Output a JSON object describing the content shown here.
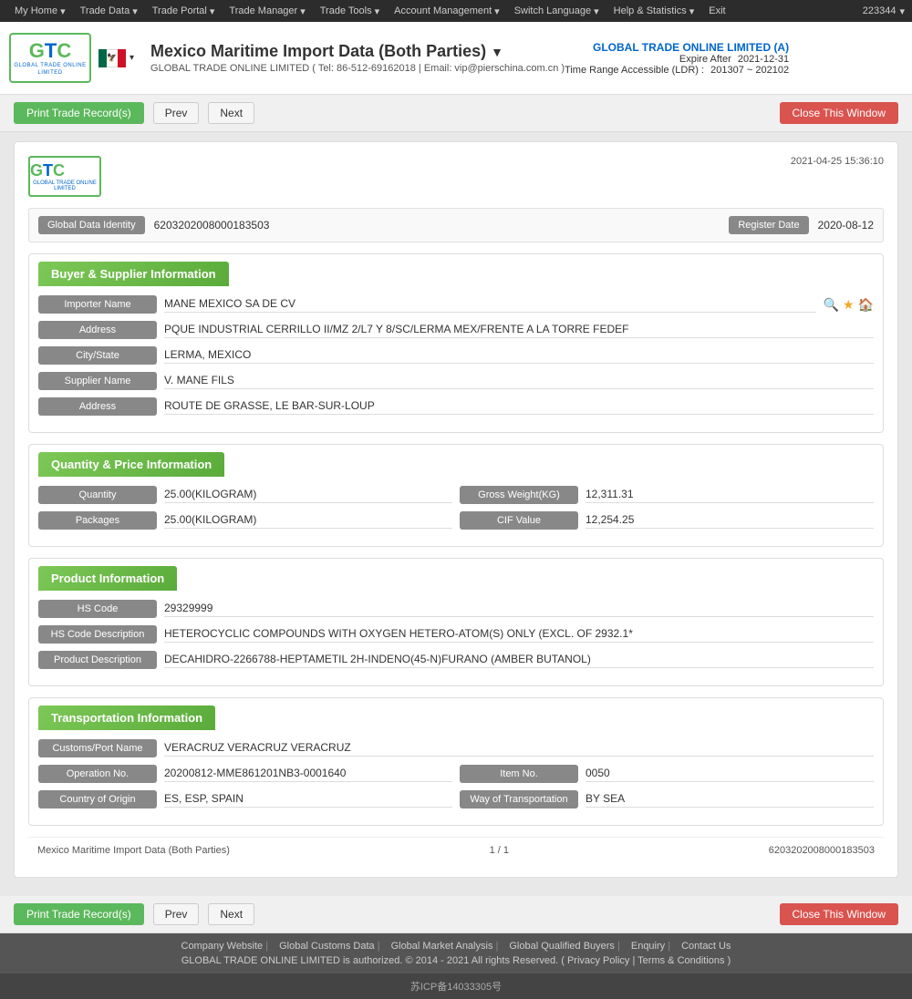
{
  "nav": {
    "items": [
      {
        "label": "My Home",
        "hasArrow": true
      },
      {
        "label": "Trade Data",
        "hasArrow": true
      },
      {
        "label": "Trade Portal",
        "hasArrow": true
      },
      {
        "label": "Trade Manager",
        "hasArrow": true
      },
      {
        "label": "Trade Tools",
        "hasArrow": true
      },
      {
        "label": "Account Management",
        "hasArrow": true
      },
      {
        "label": "Switch Language",
        "hasArrow": true
      },
      {
        "label": "Help & Statistics",
        "hasArrow": true
      },
      {
        "label": "Exit",
        "hasArrow": false
      }
    ],
    "account_number": "223344"
  },
  "header": {
    "logo_top": "GTC",
    "logo_sub": "GLOBAL TRADE ONLINE LIMITED",
    "title": "Mexico Maritime Import Data (Both Parties)",
    "has_arrow": "▼",
    "subtitle": "GLOBAL TRADE ONLINE LIMITED ( Tel: 86-512-69162018 | Email: vip@pierschina.com.cn )",
    "account_name": "GLOBAL TRADE ONLINE LIMITED (A)",
    "expire_label": "Expire After",
    "expire_date": "2021-12-31",
    "range_label": "Time Range Accessible (LDR) :",
    "range_value": "201307 ~ 202102"
  },
  "toolbar": {
    "print_label": "Print Trade Record(s)",
    "prev_label": "Prev",
    "next_label": "Next",
    "close_label": "Close This Window",
    "print_label2": "Print Trade Record(s)",
    "prev_label2": "Prev",
    "next_label2": "Next",
    "close_label2": "Close This Window"
  },
  "record": {
    "timestamp": "2021-04-25 15:36:10",
    "logo_text": "GTC",
    "logo_sub": "GLOBAL TRADE ONLINE LIMITED",
    "id_label": "Global Data Identity",
    "id_value": "6203202008000183503",
    "reg_label": "Register Date",
    "reg_value": "2020-08-12",
    "sections": {
      "buyer_supplier": {
        "title": "Buyer & Supplier Information",
        "fields": [
          {
            "label": "Importer Name",
            "value": "MANE MEXICO SA DE CV",
            "has_icons": true
          },
          {
            "label": "Address",
            "value": "PQUE INDUSTRIAL CERRILLO II/MZ 2/L7 Y 8/SC/LERMA MEX/FRENTE A LA TORRE FEDEF"
          },
          {
            "label": "City/State",
            "value": "LERMA, MEXICO"
          },
          {
            "label": "Supplier Name",
            "value": "V. MANE FILS"
          },
          {
            "label": "Address",
            "value": "ROUTE DE GRASSE, LE BAR-SUR-LOUP"
          }
        ]
      },
      "quantity_price": {
        "title": "Quantity & Price Information",
        "rows": [
          {
            "left_label": "Quantity",
            "left_value": "25.00(KILOGRAM)",
            "right_label": "Gross Weight(KG)",
            "right_value": "12,311.31"
          },
          {
            "left_label": "Packages",
            "left_value": "25.00(KILOGRAM)",
            "right_label": "CIF Value",
            "right_value": "12,254.25"
          }
        ]
      },
      "product": {
        "title": "Product Information",
        "fields": [
          {
            "label": "HS Code",
            "value": "29329999"
          },
          {
            "label": "HS Code Description",
            "value": "HETEROCYCLIC COMPOUNDS WITH OXYGEN HETERO-ATOM(S) ONLY (EXCL. OF 2932.1*"
          },
          {
            "label": "Product Description",
            "value": "DECAHIDRO-2266788-HEPTAMETIL 2H-INDENO(45-N)FURANO (AMBER BUTANOL)"
          }
        ]
      },
      "transportation": {
        "title": "Transportation Information",
        "rows": [
          {
            "label": "Customs/Port Name",
            "value": "VERACRUZ VERACRUZ VERACRUZ",
            "full": true
          },
          {
            "left_label": "Operation No.",
            "left_value": "20200812-MME861201NB3-0001640",
            "right_label": "Item No.",
            "right_value": "0050"
          },
          {
            "left_label": "Country of Origin",
            "left_value": "ES, ESP, SPAIN",
            "right_label": "Way of Transportation",
            "right_value": "BY SEA"
          }
        ]
      }
    },
    "footer": {
      "title": "Mexico Maritime Import Data (Both Parties)",
      "page": "1 / 1",
      "id": "6203202008000183503"
    }
  },
  "page_footer": {
    "icp": "苏ICP备14033305号",
    "links": [
      "Company Website",
      "Global Customs Data",
      "Global Market Analysis",
      "Global Qualified Buyers",
      "Enquiry",
      "Contact Us"
    ],
    "copyright": "GLOBAL TRADE ONLINE LIMITED is authorized. © 2014 - 2021 All rights Reserved.  (  Privacy Policy  |  Terms & Conditions  )"
  }
}
